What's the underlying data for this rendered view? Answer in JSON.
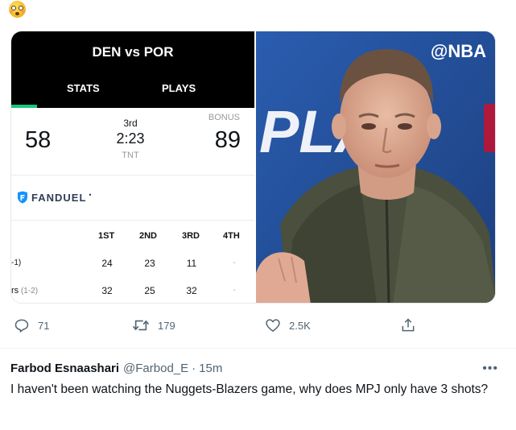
{
  "header_emoji": "flushed-face-emoji",
  "scoreboard": {
    "matchup": "DEN vs POR",
    "tabs": [
      "STATS",
      "PLAYS"
    ],
    "home_score": "58",
    "away_score": "89",
    "period": "3rd",
    "clock": "2:23",
    "network": "TNT",
    "bonus": "BONUS",
    "sponsor": "FANDUEL",
    "sponsor_mark": "•",
    "quarters": [
      "1ST",
      "2ND",
      "3RD",
      "4TH"
    ],
    "rows": [
      {
        "team": "-1)",
        "record": "",
        "q": [
          "24",
          "23",
          "11",
          "-"
        ]
      },
      {
        "team": "rs",
        "record": "(1-2)",
        "q": [
          "32",
          "25",
          "32",
          "-"
        ]
      }
    ],
    "accent": "#19c87a"
  },
  "photo": {
    "watermark": "@NBA",
    "backdrop_text": "PLA",
    "background": "#24519c"
  },
  "actions": {
    "reply_count": "71",
    "retweet_count": "179",
    "like_count": "2.5K"
  },
  "reply": {
    "name": "Farbod Esnaashari",
    "handle": "@Farbod_E",
    "separator": "·",
    "time": "15m",
    "text": "I haven't been watching the Nuggets-Blazers game, why does MPJ only have 3 shots?"
  }
}
